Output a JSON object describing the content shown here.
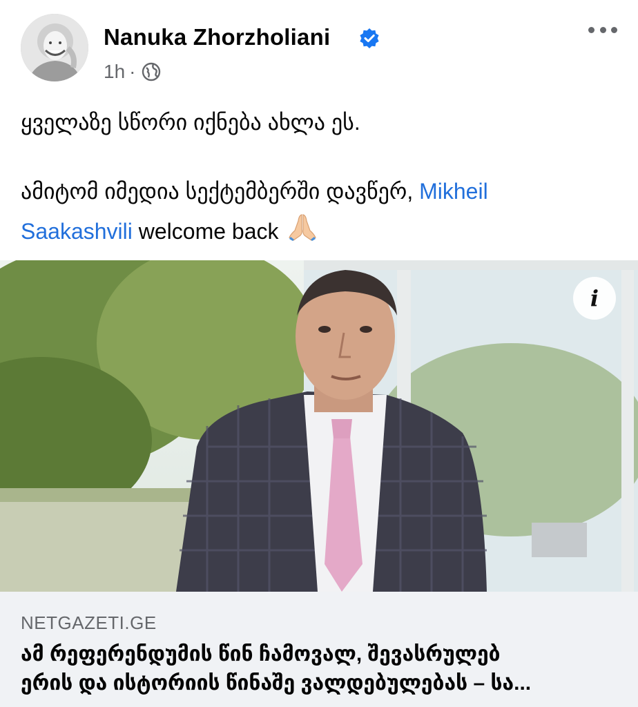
{
  "post": {
    "author": "Nanuka Zhorzholiani",
    "timestamp": "1h",
    "separator": "·",
    "text_line1": "ყველაზე სწორი იქნება ახლა ეს.",
    "text_line2_prefix": "ამიტომ იმედია სექტემბერში დავწერ, ",
    "mention_part1": "Mikheil",
    "mention_part2": "Saakashvili",
    "text_suffix": " welcome back",
    "emoji": "folded-hands-emoji"
  },
  "link_preview": {
    "domain": "NETGAZETI.GE",
    "headline_line1": "ამ რეფერენდუმის წინ ჩამოვალ, შევასრულებ",
    "headline_line2": "ერის და ისტორიის წინაშე ვალდებულებას – სა...",
    "info_icon_label": "i"
  },
  "icons": {
    "verified": "verified-badge-icon",
    "privacy": "globe-icon",
    "menu": "more-options-icon"
  },
  "colors": {
    "link": "#216fdb",
    "verified": "#1877f2",
    "secondary_text": "#65676b",
    "preview_background": "#f0f2f5"
  }
}
